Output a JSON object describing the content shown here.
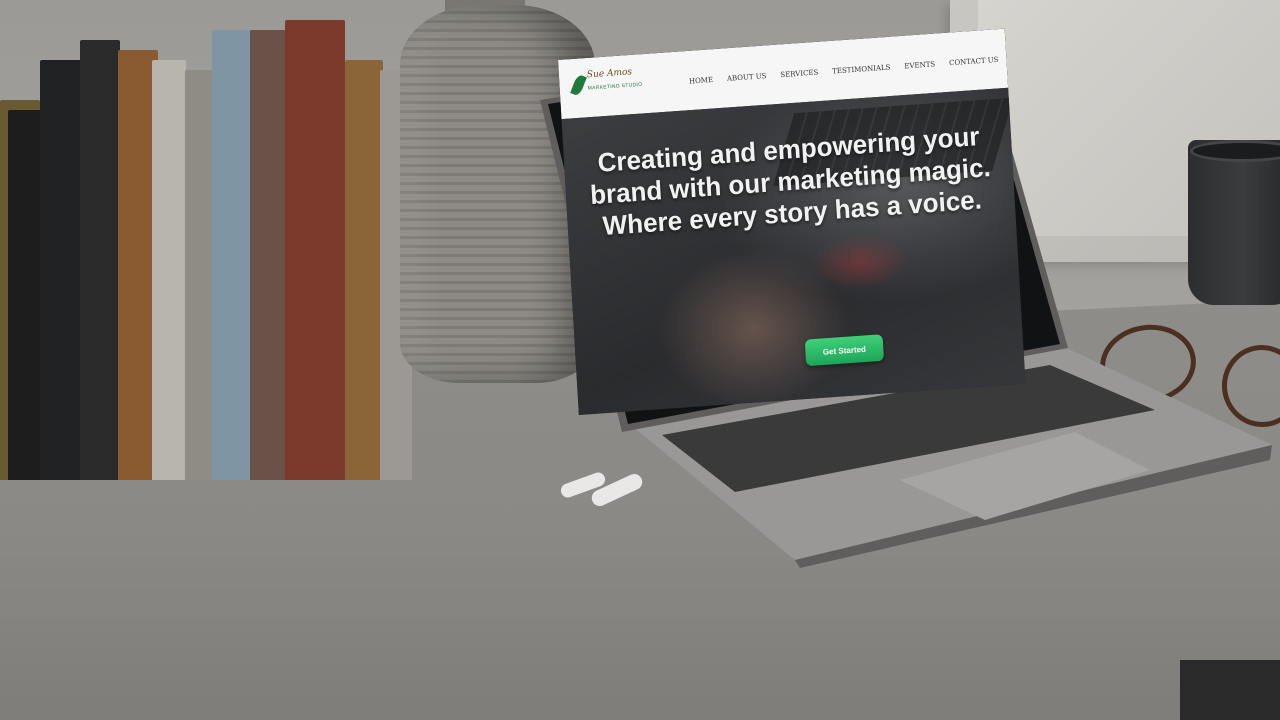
{
  "website": {
    "logo": {
      "name": "Sue Amos",
      "tagline": "MARKETING STUDIO"
    },
    "nav": [
      "HOME",
      "ABOUT US",
      "SERVICES",
      "TESTIMONIALS",
      "EVENTS",
      "CONTACT US"
    ],
    "hero": {
      "headline": "Creating and empowering your brand with our marketing magic.",
      "subline": "Where every story has a voice.",
      "cta_label": "Get Started"
    },
    "colors": {
      "cta": "#1ea558",
      "logo_green": "#1f7a3b",
      "nav_bg": "#f6f6f6"
    }
  },
  "scene": {
    "objects": [
      "books",
      "vase",
      "laptop",
      "airpods",
      "glasses",
      "mug",
      "picture-frame"
    ]
  }
}
